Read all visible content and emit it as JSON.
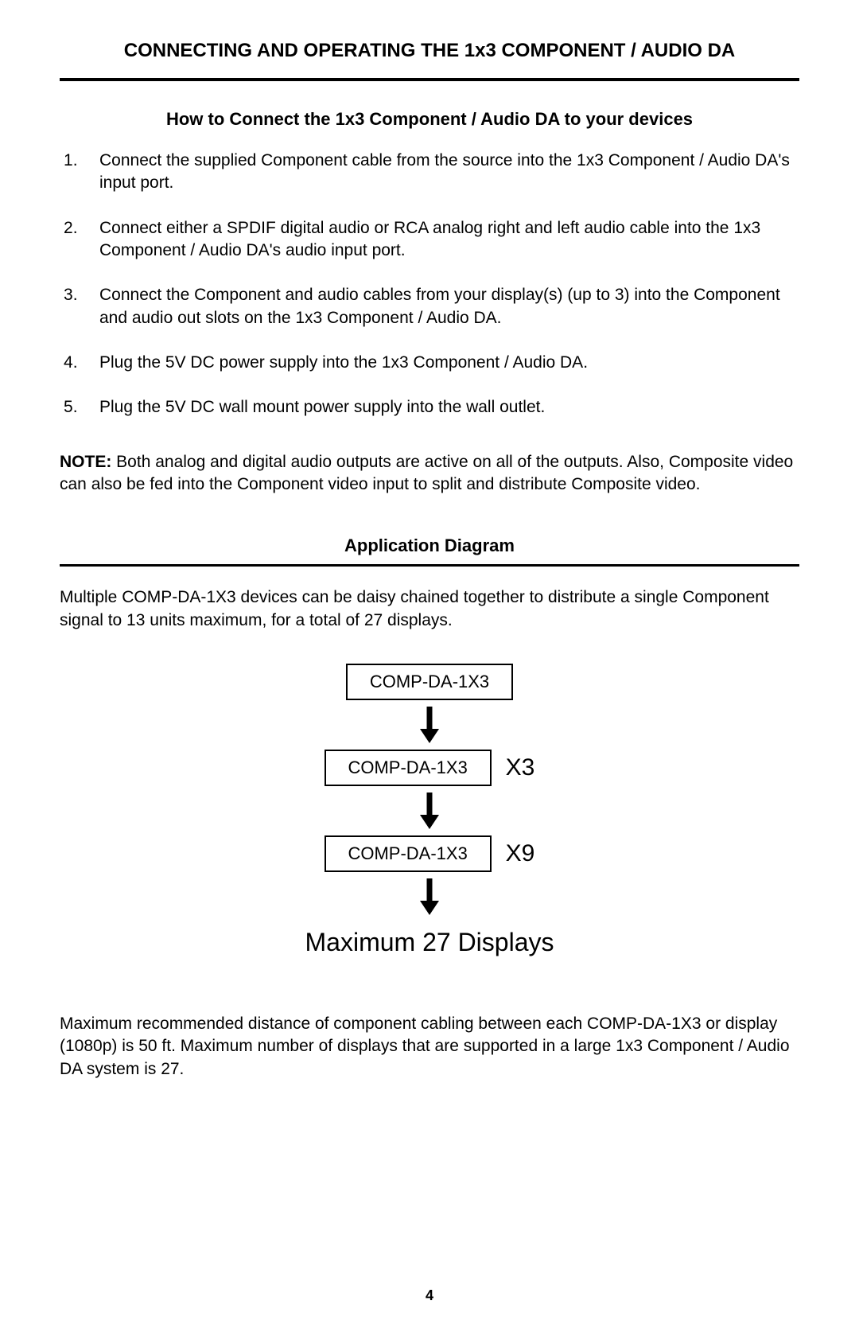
{
  "heading": "CONNECTING AND OPERATING THE 1x3 COMPONENT / AUDIO DA",
  "subheading": "How to Connect the 1x3 Component / Audio DA to your devices",
  "steps": [
    "Connect the supplied Component cable from the source into the 1x3 Component / Audio DA's input port.",
    "Connect either a SPDIF digital audio or RCA analog right and left audio cable into the 1x3 Component / Audio DA's audio input port.",
    "Connect the Component and audio cables from your display(s) (up to 3) into the Component and audio out slots on the 1x3 Component / Audio DA.",
    "Plug the 5V DC power supply into the 1x3 Component / Audio DA.",
    "Plug the 5V DC wall mount power supply into the wall outlet."
  ],
  "note_label": "NOTE:  ",
  "note_body": "Both analog and digital audio outputs are active on all of the outputs. Also, Composite video can also be fed into the Component video input to split and distribute Composite video.",
  "app_diagram_title": "Application Diagram",
  "app_diagram_desc": "Multiple COMP-DA-1X3 devices can be daisy chained together to distribute a single Component signal to 13 units maximum, for a total of 27 displays.",
  "diagram": {
    "box1": "COMP-DA-1X3",
    "box2": "COMP-DA-1X3",
    "mult2": "X3",
    "box3": "COMP-DA-1X3",
    "mult3": "X9",
    "result": "Maximum 27 Displays"
  },
  "footer_text": "Maximum recommended distance of component cabling between each COMP-DA-1X3 or display (1080p) is 50 ft. Maximum number of displays that are supported in a large 1x3 Component / Audio DA system is 27.",
  "page_number": "4"
}
